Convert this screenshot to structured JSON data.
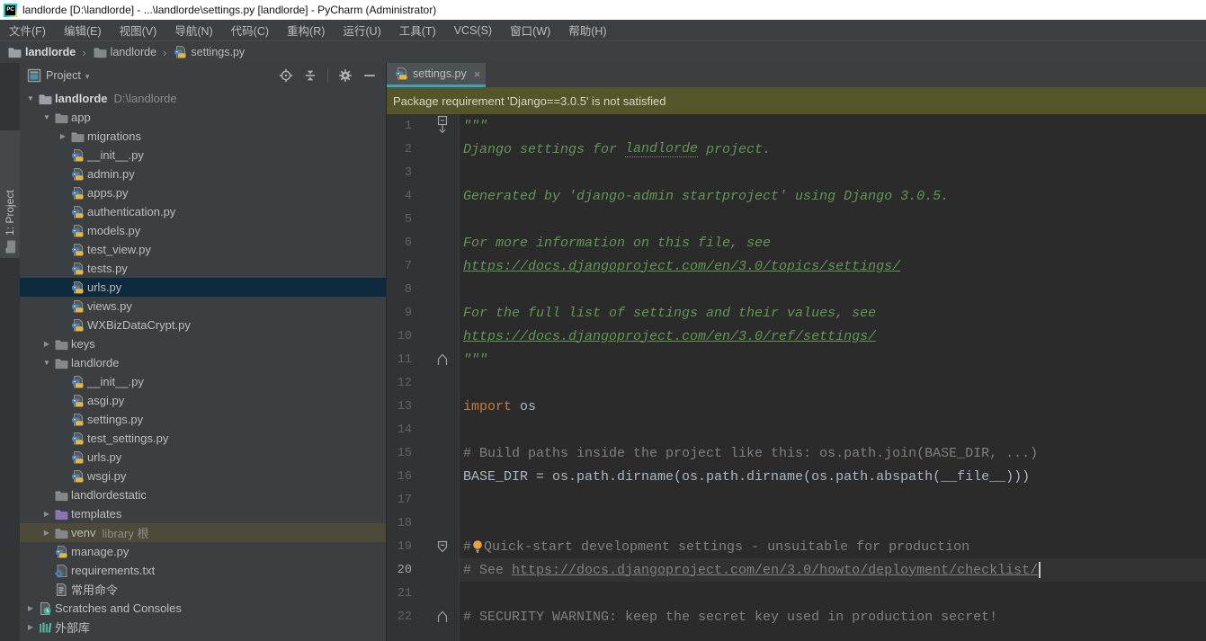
{
  "window": {
    "logo_text": "PC",
    "title": "landlorde [D:\\landlorde] - ...\\landlorde\\settings.py [landlorde] - PyCharm (Administrator)"
  },
  "menu_bar": {
    "items": [
      "文件(F)",
      "编辑(E)",
      "视图(V)",
      "导航(N)",
      "代码(C)",
      "重构(R)",
      "运行(U)",
      "工具(T)",
      "VCS(S)",
      "窗口(W)",
      "帮助(H)"
    ]
  },
  "breadcrumbs": {
    "separator": "›",
    "items": [
      {
        "label": "landlorde",
        "icon": "folder",
        "bold": true
      },
      {
        "label": "landlorde",
        "icon": "folder",
        "bold": false
      },
      {
        "label": "settings.py",
        "icon": "python-file",
        "bold": false
      }
    ]
  },
  "tool_window_stripe": {
    "project_tab": {
      "label": "1: Project",
      "icon": "folder"
    }
  },
  "project_panel": {
    "title": "Project",
    "dropdown_glyph": "▾",
    "toolbar_icons": [
      "locate-icon",
      "collapse-all-icon",
      "separator",
      "settings-gear-icon",
      "hide-icon"
    ],
    "tree": [
      {
        "label": "landlorde",
        "secondary": "D:\\landlorde",
        "icon": "folder",
        "level": 0,
        "arrow": "expanded",
        "bold": true
      },
      {
        "label": "app",
        "icon": "folder",
        "level": 1,
        "arrow": "expanded"
      },
      {
        "label": "migrations",
        "icon": "folder",
        "level": 2,
        "arrow": "collapsed"
      },
      {
        "label": "__init__.py",
        "icon": "python-file",
        "level": 2
      },
      {
        "label": "admin.py",
        "icon": "python-file",
        "level": 2
      },
      {
        "label": "apps.py",
        "icon": "python-file",
        "level": 2
      },
      {
        "label": "authentication.py",
        "icon": "python-file",
        "level": 2
      },
      {
        "label": "models.py",
        "icon": "python-file",
        "level": 2
      },
      {
        "label": "test_view.py",
        "icon": "python-file",
        "level": 2
      },
      {
        "label": "tests.py",
        "icon": "python-file",
        "level": 2
      },
      {
        "label": "urls.py",
        "icon": "python-file",
        "level": 2,
        "selected": true
      },
      {
        "label": "views.py",
        "icon": "python-file",
        "level": 2
      },
      {
        "label": "WXBizDataCrypt.py",
        "icon": "python-file",
        "level": 2
      },
      {
        "label": "keys",
        "icon": "folder",
        "level": 1,
        "arrow": "collapsed"
      },
      {
        "label": "landlorde",
        "icon": "folder",
        "level": 1,
        "arrow": "expanded"
      },
      {
        "label": "__init__.py",
        "icon": "python-file",
        "level": 2
      },
      {
        "label": "asgi.py",
        "icon": "python-file",
        "level": 2
      },
      {
        "label": "settings.py",
        "icon": "python-file",
        "level": 2
      },
      {
        "label": "test_settings.py",
        "icon": "python-file",
        "level": 2
      },
      {
        "label": "urls.py",
        "icon": "python-file",
        "level": 2
      },
      {
        "label": "wsgi.py",
        "icon": "python-file",
        "level": 2
      },
      {
        "label": "landlordestatic",
        "icon": "folder",
        "level": 1
      },
      {
        "label": "templates",
        "icon": "folder-purple",
        "level": 1,
        "arrow": "collapsed"
      },
      {
        "label": "venv",
        "secondary": "library 根",
        "icon": "folder",
        "level": 1,
        "arrow": "collapsed",
        "highlighted": true
      },
      {
        "label": "manage.py",
        "icon": "python-file",
        "level": 1
      },
      {
        "label": "requirements.txt",
        "icon": "requirements-file",
        "level": 1
      },
      {
        "label": "常用命令",
        "icon": "text-file",
        "level": 1
      },
      {
        "label": "Scratches and Consoles",
        "icon": "scratches",
        "level": 0,
        "arrow": "collapsed"
      },
      {
        "label": "外部库",
        "icon": "external-libs",
        "level": 0,
        "arrow": "collapsed"
      }
    ]
  },
  "editor": {
    "tab": {
      "label": "settings.py",
      "close_glyph": "×",
      "icon": "python-file"
    },
    "banner": {
      "text": "Package requirement 'Django==3.0.5' is not satisfied"
    },
    "code": {
      "lines": [
        {
          "n": 1,
          "fold": "start",
          "segments": [
            {
              "text": "\"\"\"",
              "style": "doc"
            }
          ]
        },
        {
          "n": 2,
          "segments": [
            {
              "text": "Django settings for ",
              "style": "doc"
            },
            {
              "text": "landlorde",
              "style": "doc typo"
            },
            {
              "text": " project.",
              "style": "doc"
            }
          ]
        },
        {
          "n": 3,
          "segments": []
        },
        {
          "n": 4,
          "segments": [
            {
              "text": "Generated by 'django-admin startproject' using Django 3.0.5.",
              "style": "doc"
            }
          ]
        },
        {
          "n": 5,
          "segments": []
        },
        {
          "n": 6,
          "segments": [
            {
              "text": "For more information on this file, see",
              "style": "doc"
            }
          ]
        },
        {
          "n": 7,
          "segments": [
            {
              "text": "https://docs.djangoproject.com/en/3.0/topics/settings/",
              "style": "doc link"
            }
          ]
        },
        {
          "n": 8,
          "segments": []
        },
        {
          "n": 9,
          "segments": [
            {
              "text": "For the full list of settings and their values, see",
              "style": "doc"
            }
          ]
        },
        {
          "n": 10,
          "segments": [
            {
              "text": "https://docs.djangoproject.com/en/3.0/ref/settings/",
              "style": "doc link"
            }
          ]
        },
        {
          "n": 11,
          "fold": "end",
          "segments": [
            {
              "text": "\"\"\"",
              "style": "doc"
            }
          ]
        },
        {
          "n": 12,
          "segments": []
        },
        {
          "n": 13,
          "segments": [
            {
              "text": "import",
              "style": "kw"
            },
            {
              "text": " os",
              "style": "code"
            }
          ]
        },
        {
          "n": 14,
          "segments": []
        },
        {
          "n": 15,
          "segments": [
            {
              "text": "# Build paths inside the project like this: os.path.join(BASE_DIR, ...)",
              "style": "cmt"
            }
          ]
        },
        {
          "n": 16,
          "segments": [
            {
              "text": "BASE_DIR = os.path.dirname(os.path.dirname(os.path.abspath(__file__)))",
              "style": "code"
            }
          ]
        },
        {
          "n": 17,
          "segments": []
        },
        {
          "n": 18,
          "segments": []
        },
        {
          "n": 19,
          "fold": "start2",
          "segments": [
            {
              "text": "#",
              "style": "cmt"
            },
            {
              "icon": "bulb"
            },
            {
              "text": "Quick-start development settings - unsuitable for production",
              "style": "cmt"
            }
          ]
        },
        {
          "n": 20,
          "current": true,
          "caret": true,
          "segments": [
            {
              "text": "# See ",
              "style": "cmt"
            },
            {
              "text": "https://docs.djangoproject.com/en/3.0/howto/deployment/checklist/",
              "style": "cmt link"
            }
          ]
        },
        {
          "n": 21,
          "segments": []
        },
        {
          "n": 22,
          "fold": "end",
          "segments": [
            {
              "text": "# SECURITY WARNING: keep the secret key used in production secret!",
              "style": "cmt"
            }
          ]
        }
      ]
    }
  },
  "colors": {
    "selection_bg": "#0d293e",
    "highlight_row_bg": "#4e4a3a",
    "banner_bg": "#545629",
    "tab_underline": "#3aa3c4",
    "docstring_green": "#629755",
    "keyword_orange": "#cc7832",
    "comment_gray": "#808080",
    "code_default": "#a9b7c6",
    "editor_bg": "#2b2b2b",
    "panel_bg": "#3c3f41",
    "gutter_bg": "#313335",
    "current_line_bg": "#323232"
  }
}
